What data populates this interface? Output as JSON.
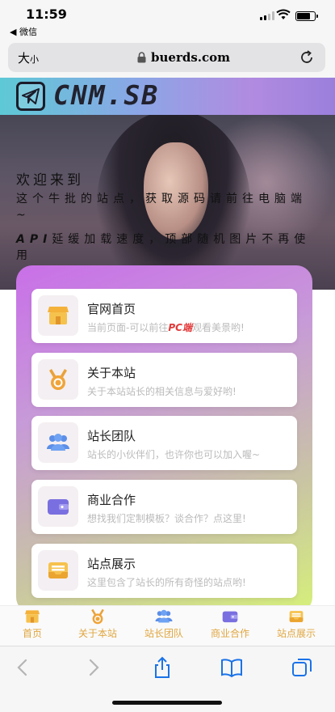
{
  "status": {
    "time": "11:59",
    "back_app": "◀ 微信"
  },
  "address_bar": {
    "text_size_label": "大",
    "text_size_small": "小",
    "url": "buerds.com"
  },
  "hero": {
    "logo_text": "CNM.SB",
    "welcome": "欢迎来到",
    "intro_line": "这个牛批的站点，获取源码请前往电脑端~",
    "api_prefix": "API",
    "api_note": "延缓加载速度，顶部随机图片不再使用"
  },
  "cards": [
    {
      "title": "官网首页",
      "subtitle_before": "当前页面-可以前往",
      "subtitle_highlight": "PC端",
      "subtitle_after": "观看美景哟!",
      "icon": "shop-icon"
    },
    {
      "title": "关于本站",
      "subtitle": "关于本站站长的相关信息与爱好哟!",
      "icon": "medal-icon"
    },
    {
      "title": "站长团队",
      "subtitle": "站长的小伙伴们，也许你也可以加入喔~",
      "icon": "team-icon"
    },
    {
      "title": "商业合作",
      "subtitle": "想找我们定制模板？谈合作？点这里!",
      "icon": "wallet-icon"
    },
    {
      "title": "站点展示",
      "subtitle": "这里包含了站长的所有奇怪的站点哟!",
      "icon": "inbox-icon"
    }
  ],
  "bottom_nav": [
    "首页",
    "关于本站",
    "站长团队",
    "商业合作",
    "站点展示"
  ],
  "colors": {
    "accent": "#e0a640",
    "panel_start": "#c96fe8",
    "panel_end": "#d6f07a",
    "highlight": "#e23b3b"
  }
}
